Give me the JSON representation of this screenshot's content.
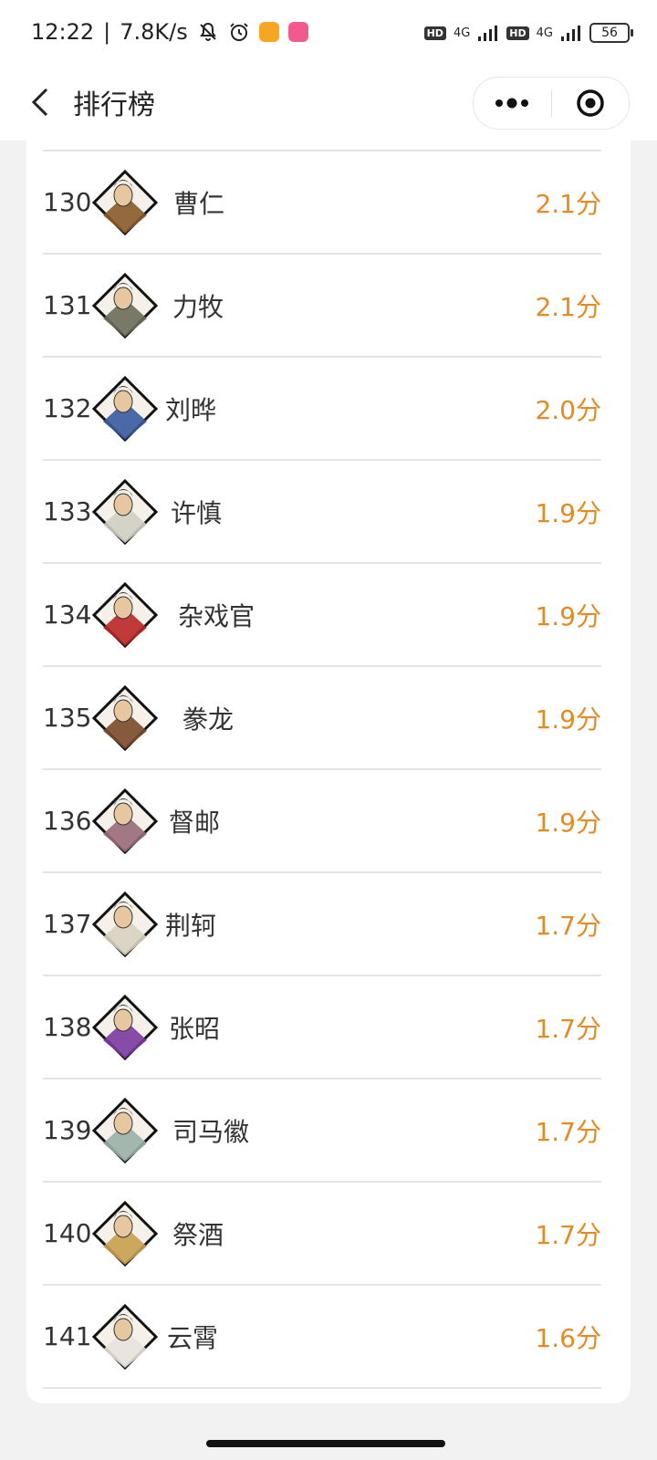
{
  "status": {
    "time": "12:22",
    "speed": "7.8K/s",
    "network1": "4G",
    "network2": "4G",
    "hd1": "HD",
    "hd2": "HD",
    "battery": "56"
  },
  "header": {
    "title": "排行榜"
  },
  "ranking": [
    {
      "rank": "130",
      "name": "曹仁",
      "score": "2.1分",
      "color": "#8b5a2b"
    },
    {
      "rank": "131",
      "name": "力牧",
      "score": "2.1分",
      "color": "#6b6b5a"
    },
    {
      "rank": "132",
      "name": "刘晔",
      "score": "2.0分",
      "color": "#3a5aa0"
    },
    {
      "rank": "133",
      "name": "许慎",
      "score": "1.9分",
      "color": "#cfcfc4"
    },
    {
      "rank": "134",
      "name": "杂戏官",
      "score": "1.9分",
      "color": "#b92626"
    },
    {
      "rank": "135",
      "name": "豢龙",
      "score": "1.9分",
      "color": "#7a4a2a"
    },
    {
      "rank": "136",
      "name": "督邮",
      "score": "1.9分",
      "color": "#9a6a7a"
    },
    {
      "rank": "137",
      "name": "荆轲",
      "score": "1.7分",
      "color": "#d8d2c2"
    },
    {
      "rank": "138",
      "name": "张昭",
      "score": "1.7分",
      "color": "#7a3aa0"
    },
    {
      "rank": "139",
      "name": "司马徽",
      "score": "1.7分",
      "color": "#9ab0a8"
    },
    {
      "rank": "140",
      "name": "祭酒",
      "score": "1.7分",
      "color": "#c8a050"
    },
    {
      "rank": "141",
      "name": "云霄",
      "score": "1.6分",
      "color": "#e8e2dc"
    }
  ],
  "colors": {
    "accent": "#e58a23",
    "divider": "#e4e4e4",
    "page_bg": "#f2f2f2"
  }
}
